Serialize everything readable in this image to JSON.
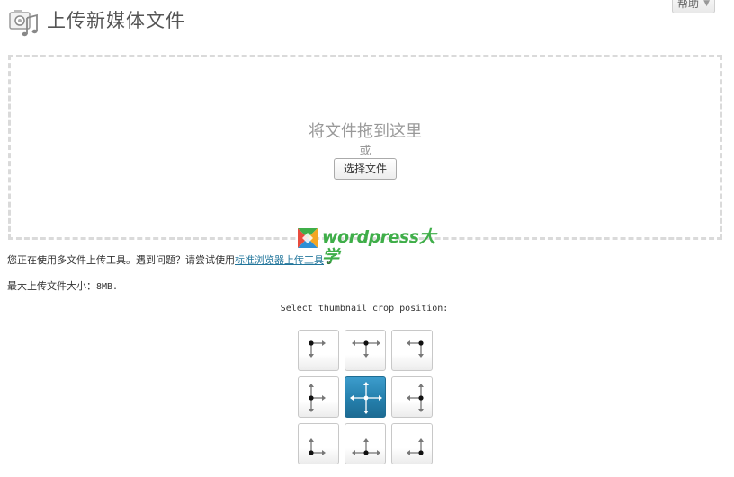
{
  "header": {
    "title": "上传新媒体文件",
    "help_label": "帮助",
    "icons": {
      "page": "media-upload-icon",
      "help_toggle": "chevron-down-icon"
    }
  },
  "upload": {
    "drop_text": "将文件拖到这里",
    "or_text": "或",
    "select_button": "选择文件"
  },
  "watermark": {
    "text": "wordpress大学",
    "icon": "wordpress-daxue-logo-icon"
  },
  "info": {
    "multi_uploader_prefix": "您正在使用多文件上传工具。遇到问题？请尝试使用",
    "browser_uploader_link": "标准浏览器上传工具",
    "multi_uploader_suffix": " 。",
    "max_size_label": "最大上传文件大小：",
    "max_size_value": "8MB."
  },
  "crop": {
    "label": "Select thumbnail crop position:",
    "positions": [
      "top-left",
      "top-center",
      "top-right",
      "middle-left",
      "center",
      "middle-right",
      "bottom-left",
      "bottom-center",
      "bottom-right"
    ],
    "selected": "center"
  },
  "colors": {
    "link": "#21759b",
    "selected_crop": "#2580ad",
    "watermark_green": "#3fae49"
  }
}
